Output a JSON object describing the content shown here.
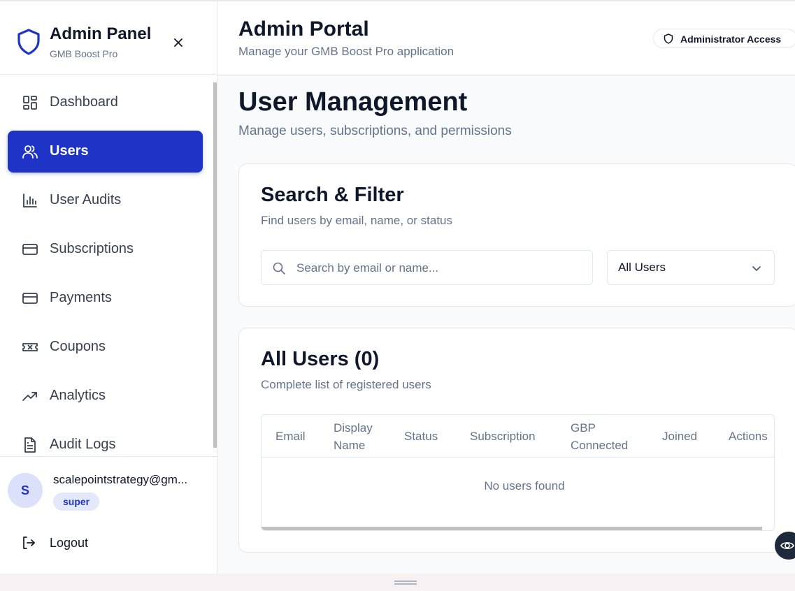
{
  "sidebar": {
    "title": "Admin Panel",
    "subtitle": "GMB Boost Pro",
    "items": [
      {
        "label": "Dashboard",
        "icon": "dashboard-icon",
        "active": false
      },
      {
        "label": "Users",
        "icon": "users-icon",
        "active": true
      },
      {
        "label": "User Audits",
        "icon": "bar-chart-icon",
        "active": false
      },
      {
        "label": "Subscriptions",
        "icon": "credit-card-icon",
        "active": false
      },
      {
        "label": "Payments",
        "icon": "credit-card-icon",
        "active": false
      },
      {
        "label": "Coupons",
        "icon": "ticket-icon",
        "active": false
      },
      {
        "label": "Analytics",
        "icon": "trending-up-icon",
        "active": false
      },
      {
        "label": "Audit Logs",
        "icon": "file-text-icon",
        "active": false
      }
    ],
    "user": {
      "initial": "S",
      "email": "scalepointstrategy@gm...",
      "role": "super"
    },
    "logout_label": "Logout"
  },
  "header": {
    "title": "Admin Portal",
    "subtitle": "Manage your GMB Boost Pro application",
    "badge": "Administrator Access"
  },
  "main": {
    "title": "User Management",
    "subtitle": "Manage users, subscriptions, and permissions",
    "filter_card": {
      "title": "Search & Filter",
      "description": "Find users by email, name, or status",
      "search_placeholder": "Search by email or name...",
      "search_value": "",
      "status_selected": "All Users"
    },
    "users_card": {
      "title": "All Users (0)",
      "description": "Complete list of registered users",
      "columns": [
        "Email",
        "Display Name",
        "Status",
        "Subscription",
        "GBP Connected",
        "Joined",
        "Actions"
      ],
      "empty_message": "No users found"
    }
  },
  "colors": {
    "primary": "#1f34c7",
    "text": "#0f172a",
    "muted": "#64748b",
    "border": "#e5e7eb"
  }
}
